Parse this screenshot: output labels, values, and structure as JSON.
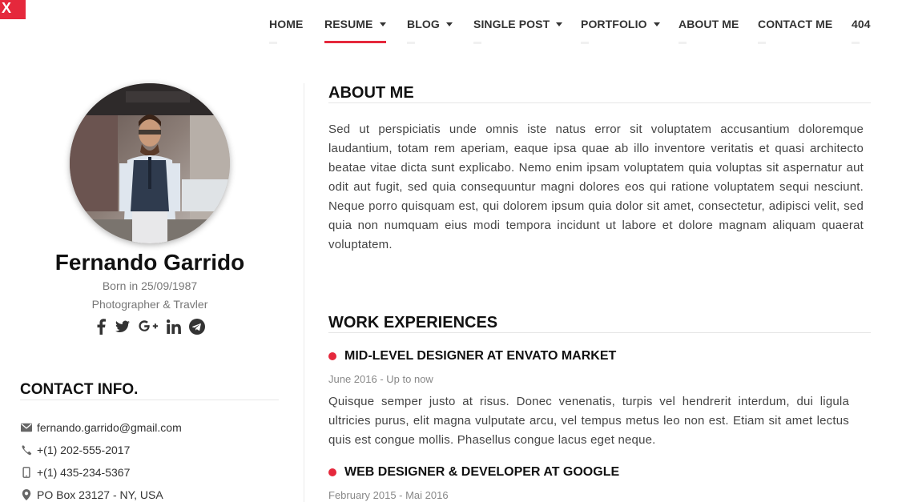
{
  "logo": {
    "text": "X",
    "color": "#e5283c"
  },
  "nav": {
    "items": [
      {
        "label": "HOME",
        "dropdown": false,
        "active": false
      },
      {
        "label": "RESUME",
        "dropdown": true,
        "active": true
      },
      {
        "label": "BLOG",
        "dropdown": true,
        "active": false
      },
      {
        "label": "SINGLE POST",
        "dropdown": true,
        "active": false
      },
      {
        "label": "PORTFOLIO",
        "dropdown": true,
        "active": false
      },
      {
        "label": "ABOUT ME",
        "dropdown": false,
        "active": false
      },
      {
        "label": "CONTACT ME",
        "dropdown": false,
        "active": false
      },
      {
        "label": "404",
        "dropdown": false,
        "active": false
      }
    ]
  },
  "profile": {
    "name": "Fernando Garrido",
    "born": "Born in 25/09/1987",
    "role": "Photographer & Travler",
    "socials": [
      "facebook-icon",
      "twitter-icon",
      "google-plus-icon",
      "linkedin-icon",
      "telegram-icon"
    ]
  },
  "contact": {
    "heading": "CONTACT INFO.",
    "email": "fernando.garrido@gmail.com",
    "phone": "+(1) 202-555-2017",
    "mobile": "+(1) 435-234-5367",
    "address": "PO Box 23127 - NY, USA"
  },
  "about": {
    "heading": "ABOUT ME",
    "text": "Sed ut perspiciatis unde omnis iste natus error sit voluptatem accusantium doloremque laudantium, totam rem aperiam, eaque ipsa quae ab illo inventore veritatis et quasi architecto beatae vitae dicta sunt explicabo. Nemo enim ipsam voluptatem quia voluptas sit aspernatur aut odit aut fugit, sed quia consequuntur magni dolores eos qui ratione voluptatem sequi nesciunt. Neque porro quisquam est, qui dolorem ipsum quia dolor sit amet, consectetur, adipisci velit, sed quia non numquam eius modi tempora incidunt ut labore et dolore magnam aliquam quaerat voluptatem."
  },
  "work": {
    "heading": "WORK EXPERIENCES",
    "jobs": [
      {
        "title": "MID-LEVEL DESIGNER AT ENVATO MARKET",
        "date": "June 2016 - Up to now",
        "desc": "Quisque semper justo at risus. Donec venenatis, turpis vel hendrerit interdum, dui ligula ultricies purus, elit magna vulputate arcu, vel tempus metus leo non est. Etiam sit amet lectus quis est congue mollis. Phasellus congue lacus eget neque."
      },
      {
        "title": "WEB DESIGNER & DEVELOPER AT GOOGLE",
        "date": "February 2015 - Mai 2016",
        "desc": ""
      }
    ]
  },
  "colors": {
    "accent": "#e5283c",
    "text": "#444444",
    "heading": "#111111"
  }
}
